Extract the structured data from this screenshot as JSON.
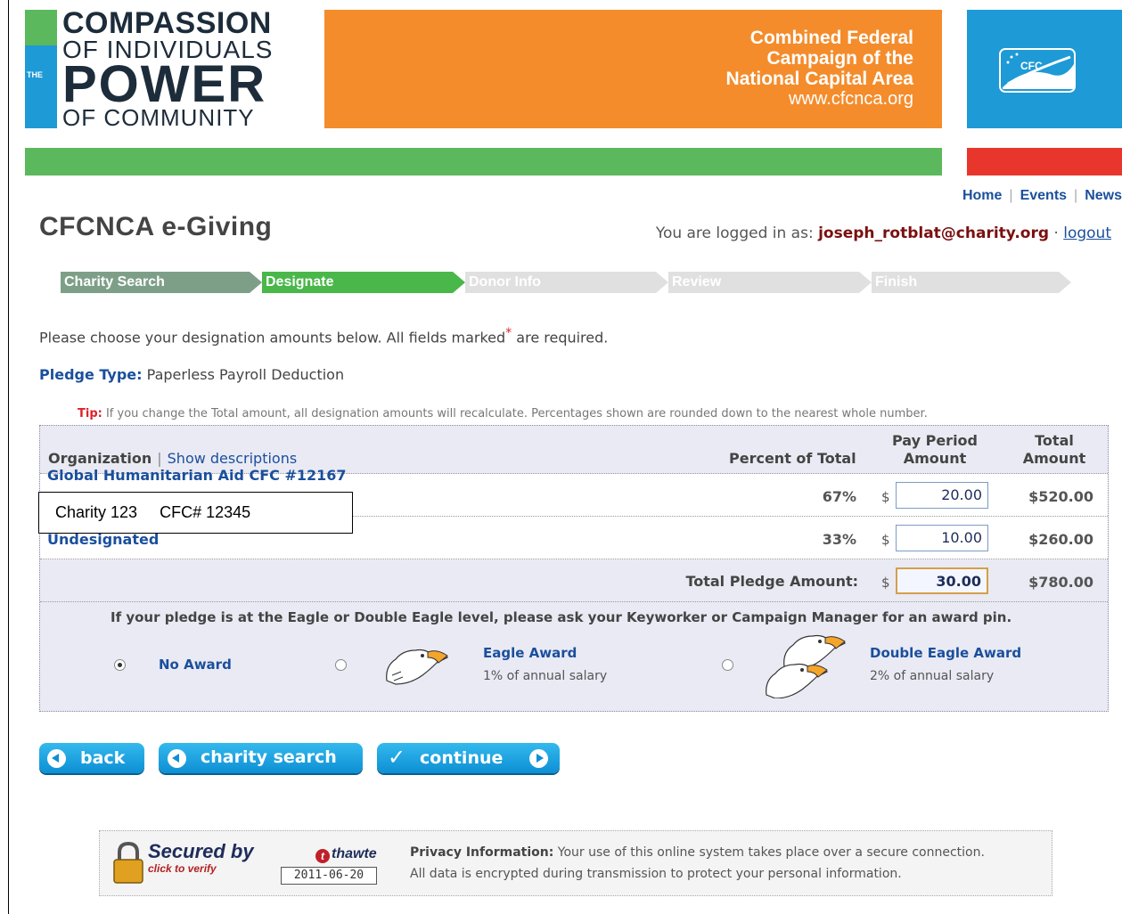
{
  "banner": {
    "logo": {
      "the": "THE",
      "line1": "COMPASSION",
      "line2": "OF INDIVIDUALS",
      "line3": "POWER",
      "line4": "OF COMMUNITY"
    },
    "campaign": {
      "line1": "Combined Federal",
      "line2": "Campaign of the",
      "line3": "National Capital Area",
      "url": "www.cfcnca.org"
    },
    "cfc_logo_text": "CFC"
  },
  "topnav": {
    "home": "Home",
    "events": "Events",
    "news": "News"
  },
  "page_title": "CFCNCA e-Giving",
  "login": {
    "prefix": "You are logged in as:",
    "user": "joseph_rotblat@charity.org",
    "dot": "·",
    "logout": "logout"
  },
  "steps": [
    "Charity Search",
    "Designate",
    "Donor Info",
    "Review",
    "Finish"
  ],
  "intro": {
    "before": "Please choose your designation amounts below. All fields marked",
    "star": "*",
    "after": "are required."
  },
  "pledge": {
    "label": "Pledge Type:",
    "value": "Paperless Payroll Deduction"
  },
  "tip": {
    "label": "Tip:",
    "text": "If you change the Total amount, all designation amounts will recalculate. Percentages shown are rounded down to the nearest whole number."
  },
  "table": {
    "headers": {
      "organization": "Organization",
      "show_descriptions": "Show descriptions",
      "percent": "Percent of Total",
      "pay_period_1": "Pay Period",
      "pay_period_2": "Amount",
      "total_1": "Total",
      "total_2": "Amount"
    },
    "rows": [
      {
        "org": "Global Humanitarian Aid  CFC #12167",
        "percent": "67%",
        "currency": "$",
        "amount": "20.00",
        "total": "$520.00"
      },
      {
        "org": "Undesignated",
        "percent": "33%",
        "currency": "$",
        "amount": "10.00",
        "total": "$260.00"
      }
    ],
    "total_row": {
      "label": "Total Pledge Amount:",
      "currency": "$",
      "amount": "30.00",
      "total": "$780.00"
    }
  },
  "overlay": {
    "name": "Charity 123",
    "cfc": "CFC# 12345"
  },
  "awards": {
    "note": "If your pledge is at the Eagle or Double Eagle level, please ask your Keyworker or Campaign Manager for an award pin.",
    "options": [
      {
        "label": "No Award",
        "sub": "",
        "selected": true
      },
      {
        "label": "Eagle Award",
        "sub": "1% of annual salary",
        "selected": false
      },
      {
        "label": "Double Eagle Award",
        "sub": "2% of annual salary",
        "selected": false
      }
    ]
  },
  "buttons": {
    "back": "back",
    "charity_search": "charity search",
    "continue": "continue"
  },
  "footer": {
    "secured_by": "Secured by",
    "thawte": "thawte",
    "click_to_verify": "click to verify",
    "date": "2011-06-20",
    "privacy_label": "Privacy Information:",
    "privacy_line1": "Your use of this online system takes place over a secure connection.",
    "privacy_line2": "All data is encrypted during transmission to protect your personal information."
  },
  "colors": {
    "orange": "#f48c2c",
    "blue": "#1e9ad6",
    "green": "#5cb85c",
    "red": "#e8362c",
    "link": "#1a4f9c"
  }
}
